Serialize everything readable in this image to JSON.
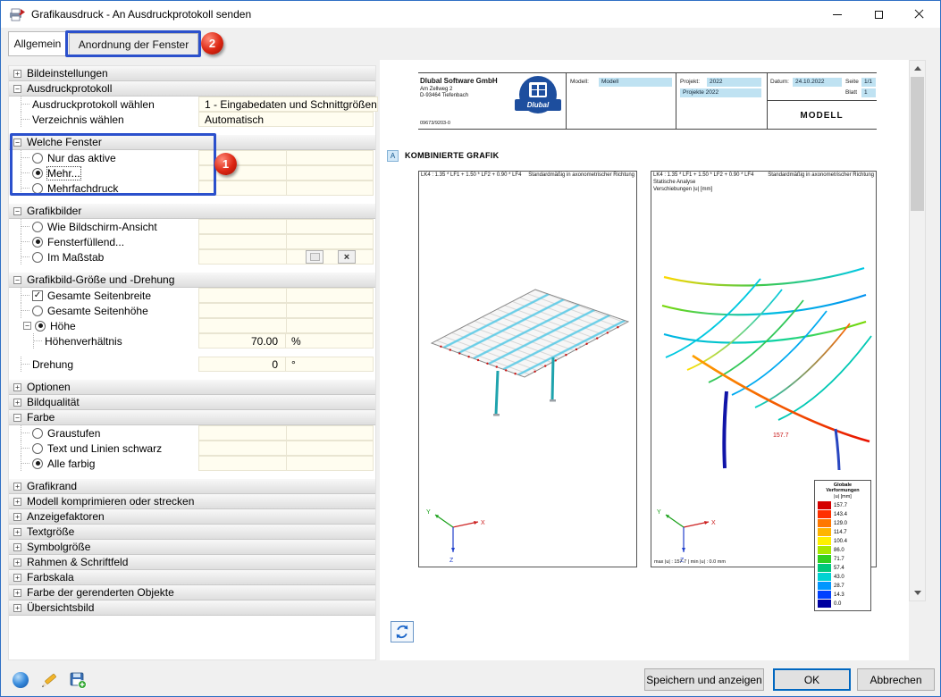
{
  "titlebar": {
    "title": "Grafikausdruck - An Ausdruckprotokoll senden"
  },
  "tabs": {
    "general": "Allgemein",
    "arrangement": "Anordnung der Fenster"
  },
  "badges": {
    "step1": "1",
    "step2": "2"
  },
  "annotations": {
    "box_color": "#2b50cc",
    "badge_color": "#dc2612"
  },
  "panel": {
    "rows": [
      {
        "type": "header",
        "expand": "plus",
        "label": "Bildeinstellungen",
        "name": "section-bildeinstellungen"
      },
      {
        "type": "header",
        "expand": "minus",
        "label": "Ausdruckprotokoll",
        "name": "section-ausdruckprotokoll"
      },
      {
        "type": "item",
        "cells": "full",
        "label": "Ausdruckprotokoll wählen",
        "value": "1 - Eingabedaten und Schnittgrößen",
        "name": "row-ausdruckprotokoll-waehlen"
      },
      {
        "type": "item",
        "cells": "full",
        "label": "Verzeichnis wählen",
        "value": "Automatisch",
        "name": "row-verzeichnis-waehlen"
      },
      {
        "type": "gap"
      },
      {
        "type": "header",
        "expand": "minus",
        "label": "Welche Fenster",
        "name": "section-welche-fenster"
      },
      {
        "type": "radio",
        "cells": "split",
        "label": "Nur das aktive",
        "checked": false,
        "name": "radio-nur-das-aktive"
      },
      {
        "type": "radio",
        "cells": "split",
        "label": "Mehr...",
        "checked": true,
        "focus": true,
        "name": "radio-mehr"
      },
      {
        "type": "radio",
        "cells": "split",
        "label": "Mehrfachdruck",
        "checked": false,
        "name": "radio-mehrfachdruck"
      },
      {
        "type": "gap"
      },
      {
        "type": "header",
        "expand": "minus",
        "label": "Grafikbilder",
        "name": "section-grafikbilder"
      },
      {
        "type": "radio",
        "cells": "split",
        "label": "Wie Bildschirm-Ansicht",
        "checked": false,
        "name": "radio-wie-bildschirm-ansicht"
      },
      {
        "type": "radio",
        "cells": "split",
        "label": "Fensterfüllend...",
        "checked": true,
        "name": "radio-fensterfuellend"
      },
      {
        "type": "radio",
        "cells": "split",
        "label": "Im Maßstab",
        "checked": false,
        "buttons": true,
        "name": "radio-im-massstab"
      },
      {
        "type": "gap"
      },
      {
        "type": "header",
        "expand": "minus",
        "label": "Grafikbild-Größe und -Drehung",
        "name": "section-grafikbild-groesse-und-drehung"
      },
      {
        "type": "check",
        "cells": "split",
        "label": "Gesamte Seitenbreite",
        "checked": true,
        "name": "check-gesamte-seitenbreite"
      },
      {
        "type": "radio",
        "cells": "split",
        "label": "Gesamte Seitenhöhe",
        "checked": false,
        "name": "radio-gesamte-seitenhoehe"
      },
      {
        "type": "radio",
        "cells": "split",
        "label": "Höhe",
        "checked": true,
        "expand": "minus",
        "name": "radio-hoehe"
      },
      {
        "type": "item",
        "cells": "input",
        "label": "Höhenverhältnis",
        "value": "70.00",
        "unit": "%",
        "indent": 1,
        "name": "row-hoehenverhaeltnis"
      },
      {
        "type": "gap"
      },
      {
        "type": "item",
        "cells": "input",
        "label": "Drehung",
        "value": "0",
        "unit": "°",
        "name": "row-drehung"
      },
      {
        "type": "gap"
      },
      {
        "type": "header",
        "expand": "plus",
        "label": "Optionen",
        "name": "section-optionen"
      },
      {
        "type": "header",
        "expand": "plus",
        "label": "Bildqualität",
        "name": "section-bildqualitaet"
      },
      {
        "type": "header",
        "expand": "minus",
        "label": "Farbe",
        "name": "section-farbe"
      },
      {
        "type": "radio",
        "cells": "split",
        "label": "Graustufen",
        "checked": false,
        "name": "radio-graustufen"
      },
      {
        "type": "radio",
        "cells": "split",
        "label": "Text und Linien schwarz",
        "checked": false,
        "name": "radio-text-und-linien-schwarz"
      },
      {
        "type": "radio",
        "cells": "split",
        "label": "Alle farbig",
        "checked": true,
        "name": "radio-alle-farbig"
      },
      {
        "type": "gap"
      },
      {
        "type": "header",
        "expand": "plus",
        "label": "Grafikrand",
        "name": "section-grafikrand"
      },
      {
        "type": "header",
        "expand": "plus",
        "label": "Modell komprimieren oder strecken",
        "name": "section-modell-komprimieren"
      },
      {
        "type": "header",
        "expand": "plus",
        "label": "Anzeigefaktoren",
        "name": "section-anzeigefaktoren"
      },
      {
        "type": "header",
        "expand": "plus",
        "label": "Textgröße",
        "name": "section-textgroesse"
      },
      {
        "type": "header",
        "expand": "plus",
        "label": "Symbolgröße",
        "name": "section-symbolgroesse"
      },
      {
        "type": "header",
        "expand": "plus",
        "label": "Rahmen & Schriftfeld",
        "name": "section-rahmen-schriftfeld"
      },
      {
        "type": "header",
        "expand": "plus",
        "label": "Farbskala",
        "name": "section-farbskala"
      },
      {
        "type": "header",
        "expand": "plus",
        "label": "Farbe der gerenderten Objekte",
        "name": "section-farbe-der-gerenderten-objekte"
      },
      {
        "type": "header",
        "expand": "plus",
        "label": "Übersichtsbild",
        "name": "section-uebersichtsbild"
      }
    ]
  },
  "preview": {
    "header": {
      "company": "Dlubal Software GmbH",
      "address1": "Am Zellweg 2",
      "address2": "D-93464 Tiefenbach",
      "phone": "09673/9203-0",
      "logo": "Dlubal",
      "model_label": "Modell:",
      "model_value": "Modell",
      "project_label": "Projekt:",
      "project_value": "2022",
      "project_folder": "Projekte 2022",
      "date_label": "Datum:",
      "date_value": "24.10.2022",
      "page_label": "Seite",
      "page_value": "1/1",
      "sheet_label": "Blatt",
      "sheet_value": "1",
      "model_box": "MODELL"
    },
    "section": {
      "marker": "A",
      "title": "KOMBINIERTE GRAFIK"
    },
    "left_graphic": {
      "combo": "LK4 : 1.35 * LF1 + 1.50 * LF2 + 0.90 * LF4",
      "direction": "Standardmäßig in axonometrischer Richtung"
    },
    "right_graphic": {
      "combo": "LK4 : 1.35 * LF1 + 1.50 * LF2 + 0.90 * LF4",
      "direction": "Standardmäßig in axonometrischer Richtung",
      "analysis": "Statische Analyse",
      "quantity": "Verschiebungen |u| [mm]",
      "max_value_label": "157.7",
      "footer": "max |u| : 157.7 | min |u| : 0.0 mm"
    },
    "legend": {
      "title": "Globale Verformungen",
      "subtitle": "|u| [mm]",
      "entries": [
        {
          "value": "157.7",
          "color": "#d40000"
        },
        {
          "value": "143.4",
          "color": "#ff3000"
        },
        {
          "value": "129.0",
          "color": "#ff7800"
        },
        {
          "value": "114.7",
          "color": "#ffb400"
        },
        {
          "value": "100.4",
          "color": "#fff000"
        },
        {
          "value": "86.0",
          "color": "#a8e800"
        },
        {
          "value": "71.7",
          "color": "#30d020"
        },
        {
          "value": "57.4",
          "color": "#00c87c"
        },
        {
          "value": "43.0",
          "color": "#00d2d2"
        },
        {
          "value": "28.7",
          "color": "#0096ff"
        },
        {
          "value": "14.3",
          "color": "#0040ff"
        },
        {
          "value": "0.0",
          "color": "#0000a0"
        }
      ]
    },
    "axes": {
      "x": "X",
      "y": "Y",
      "z": "Z"
    }
  },
  "footer": {
    "save_and_show": "Speichern und anzeigen",
    "ok": "OK",
    "cancel": "Abbrechen"
  }
}
